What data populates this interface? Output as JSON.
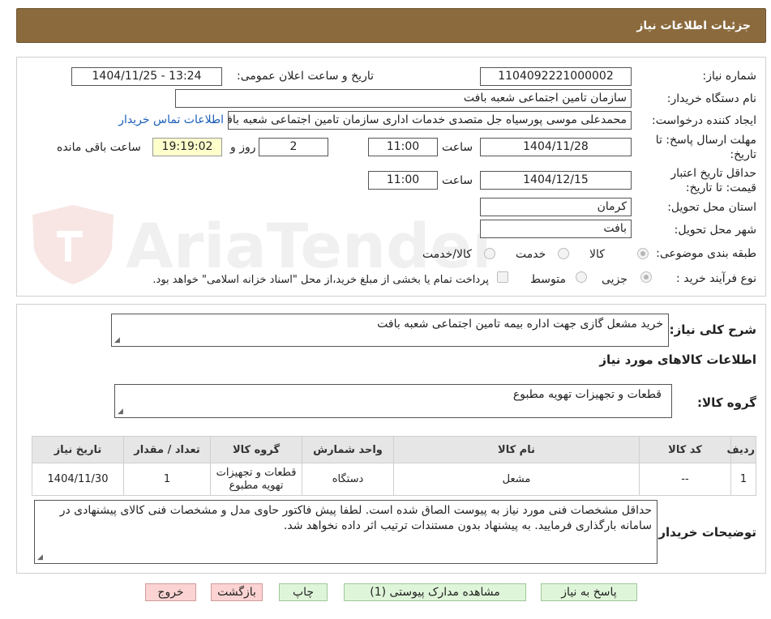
{
  "header": {
    "title": "جزئیات اطلاعات نیاز"
  },
  "form": {
    "need_number_label": "شماره نیاز:",
    "need_number": "1104092221000002",
    "announce_label": "تاریخ و ساعت اعلان عمومی:",
    "announce_value": "1404/11/25 - 13:24",
    "buyer_org_label": "نام دستگاه خریدار:",
    "buyer_org": "سازمان تامین اجتماعی شعبه بافت",
    "creator_label": "ایجاد کننده درخواست:",
    "creator": "محمدعلی موسی پورسیاه جل متصدی خدمات اداری سازمان تامین اجتماعی شعبه بافت",
    "contact_link": "اطلاعات تماس خریدار",
    "deadline_label_1": "مهلت ارسال پاسخ: تا",
    "deadline_label_2": "تاریخ:",
    "deadline_date": "1404/11/28",
    "time_label": "ساعت",
    "deadline_time": "11:00",
    "days_value": "2",
    "days_label": "روز و",
    "remaining_time": "19:19:02",
    "remaining_label": "ساعت باقی مانده",
    "validity_label_1": "حداقل تاریخ اعتبار",
    "validity_label_2": "قیمت: تا تاریخ:",
    "validity_date": "1404/12/15",
    "validity_time": "11:00",
    "province_label": "استان محل تحویل:",
    "province": "کرمان",
    "city_label": "شهر محل تحویل:",
    "city": "بافت",
    "category_label": "طبقه بندی موضوعی:",
    "category_options": [
      "کالا",
      "خدمت",
      "کالا/خدمت"
    ],
    "category_selected": "کالا",
    "process_label": "نوع فرآیند خرید :",
    "process_options": [
      "جزیی",
      "متوسط"
    ],
    "process_selected": "جزیی",
    "payment_note": "پرداخت تمام یا بخشی از مبلغ خرید،از محل \"اسناد خزانه اسلامی\" خواهد بود."
  },
  "watermark": "AriaTender.neT",
  "details": {
    "summary_label": "شرح کلی نیاز:",
    "summary": "خرید مشعل گازی جهت اداره بیمه تامین اجتماعی شعبه بافت",
    "goods_info_title": "اطلاعات کالاهای مورد نیاز",
    "goods_group_label": "گروه کالا:",
    "goods_group": "قطعات و تجهیزات تهویه مطبوع",
    "table": {
      "headers": [
        "ردیف",
        "کد کالا",
        "نام کالا",
        "واحد شمارش",
        "گروه کالا",
        "تعداد / مقدار",
        "تاریخ نیاز"
      ],
      "rows": [
        [
          "1",
          "--",
          "مشعل",
          "دستگاه",
          "قطعات و تجهیزات تهویه مطبوع",
          "1",
          "1404/11/30"
        ]
      ]
    },
    "buyer_notes_label": "توضیحات خریدار:",
    "buyer_notes": "حداقل مشخصات فنی مورد نیاز به پیوست الصاق شده است. لطفا پیش فاکتور حاوی مدل و مشخصات فنی کالای پیشنهادی در سامانه بارگذاری فرمایید. به پیشنهاد بدون مستندات ترتیب اثر داده نخواهد شد."
  },
  "buttons": {
    "reply": "پاسخ به نیاز",
    "view_docs": "مشاهده مدارک پیوستی (1)",
    "print": "چاپ",
    "back": "بازگشت",
    "exit": "خروج"
  }
}
